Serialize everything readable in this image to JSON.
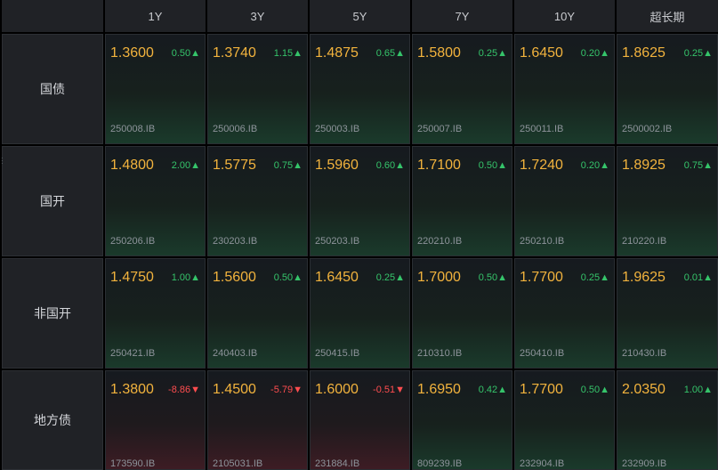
{
  "header": {
    "columns": [
      "1Y",
      "3Y",
      "5Y",
      "7Y",
      "10Y",
      "超长期"
    ]
  },
  "rows": [
    {
      "label": "国债",
      "cells": [
        {
          "price": "1.3600",
          "change": "0.50▲",
          "code": "250008.IB",
          "dir": "up"
        },
        {
          "price": "1.3740",
          "change": "1.15▲",
          "code": "250006.IB",
          "dir": "up"
        },
        {
          "price": "1.4875",
          "change": "0.65▲",
          "code": "250003.IB",
          "dir": "up"
        },
        {
          "price": "1.5800",
          "change": "0.25▲",
          "code": "250007.IB",
          "dir": "up"
        },
        {
          "price": "1.6450",
          "change": "0.20▲",
          "code": "250011.IB",
          "dir": "up"
        },
        {
          "price": "1.8625",
          "change": "0.25▲",
          "code": "2500002.IB",
          "dir": "up"
        }
      ]
    },
    {
      "label": "国开",
      "cells": [
        {
          "price": "1.4800",
          "change": "2.00▲",
          "code": "250206.IB",
          "dir": "up"
        },
        {
          "price": "1.5775",
          "change": "0.75▲",
          "code": "230203.IB",
          "dir": "up"
        },
        {
          "price": "1.5960",
          "change": "0.60▲",
          "code": "250203.IB",
          "dir": "up"
        },
        {
          "price": "1.7100",
          "change": "0.50▲",
          "code": "220210.IB",
          "dir": "up"
        },
        {
          "price": "1.7240",
          "change": "0.20▲",
          "code": "250210.IB",
          "dir": "up"
        },
        {
          "price": "1.8925",
          "change": "0.75▲",
          "code": "210220.IB",
          "dir": "up"
        }
      ]
    },
    {
      "label": "非国开",
      "cells": [
        {
          "price": "1.4750",
          "change": "1.00▲",
          "code": "250421.IB",
          "dir": "up"
        },
        {
          "price": "1.5600",
          "change": "0.50▲",
          "code": "240403.IB",
          "dir": "up"
        },
        {
          "price": "1.6450",
          "change": "0.25▲",
          "code": "250415.IB",
          "dir": "up"
        },
        {
          "price": "1.7000",
          "change": "0.50▲",
          "code": "210310.IB",
          "dir": "up"
        },
        {
          "price": "1.7700",
          "change": "0.25▲",
          "code": "250410.IB",
          "dir": "up"
        },
        {
          "price": "1.9625",
          "change": "0.01▲",
          "code": "210430.IB",
          "dir": "up"
        }
      ]
    },
    {
      "label": "地方债",
      "cells": [
        {
          "price": "1.3800",
          "change": "-8.86▼",
          "code": "173590.IB",
          "dir": "down"
        },
        {
          "price": "1.4500",
          "change": "-5.79▼",
          "code": "2105031.IB",
          "dir": "down"
        },
        {
          "price": "1.6000",
          "change": "-0.51▼",
          "code": "231884.IB",
          "dir": "down"
        },
        {
          "price": "1.6950",
          "change": "0.42▲",
          "code": "809239.IB",
          "dir": "up"
        },
        {
          "price": "1.7700",
          "change": "0.50▲",
          "code": "232904.IB",
          "dir": "up"
        },
        {
          "price": "2.0350",
          "change": "1.00▲",
          "code": "232909.IB",
          "dir": "up"
        }
      ]
    }
  ],
  "colors": {
    "price": "#f2b33d",
    "up": "#35c46a",
    "down": "#ff4d4f",
    "code": "#8e949b",
    "header_bg": "#202226"
  }
}
